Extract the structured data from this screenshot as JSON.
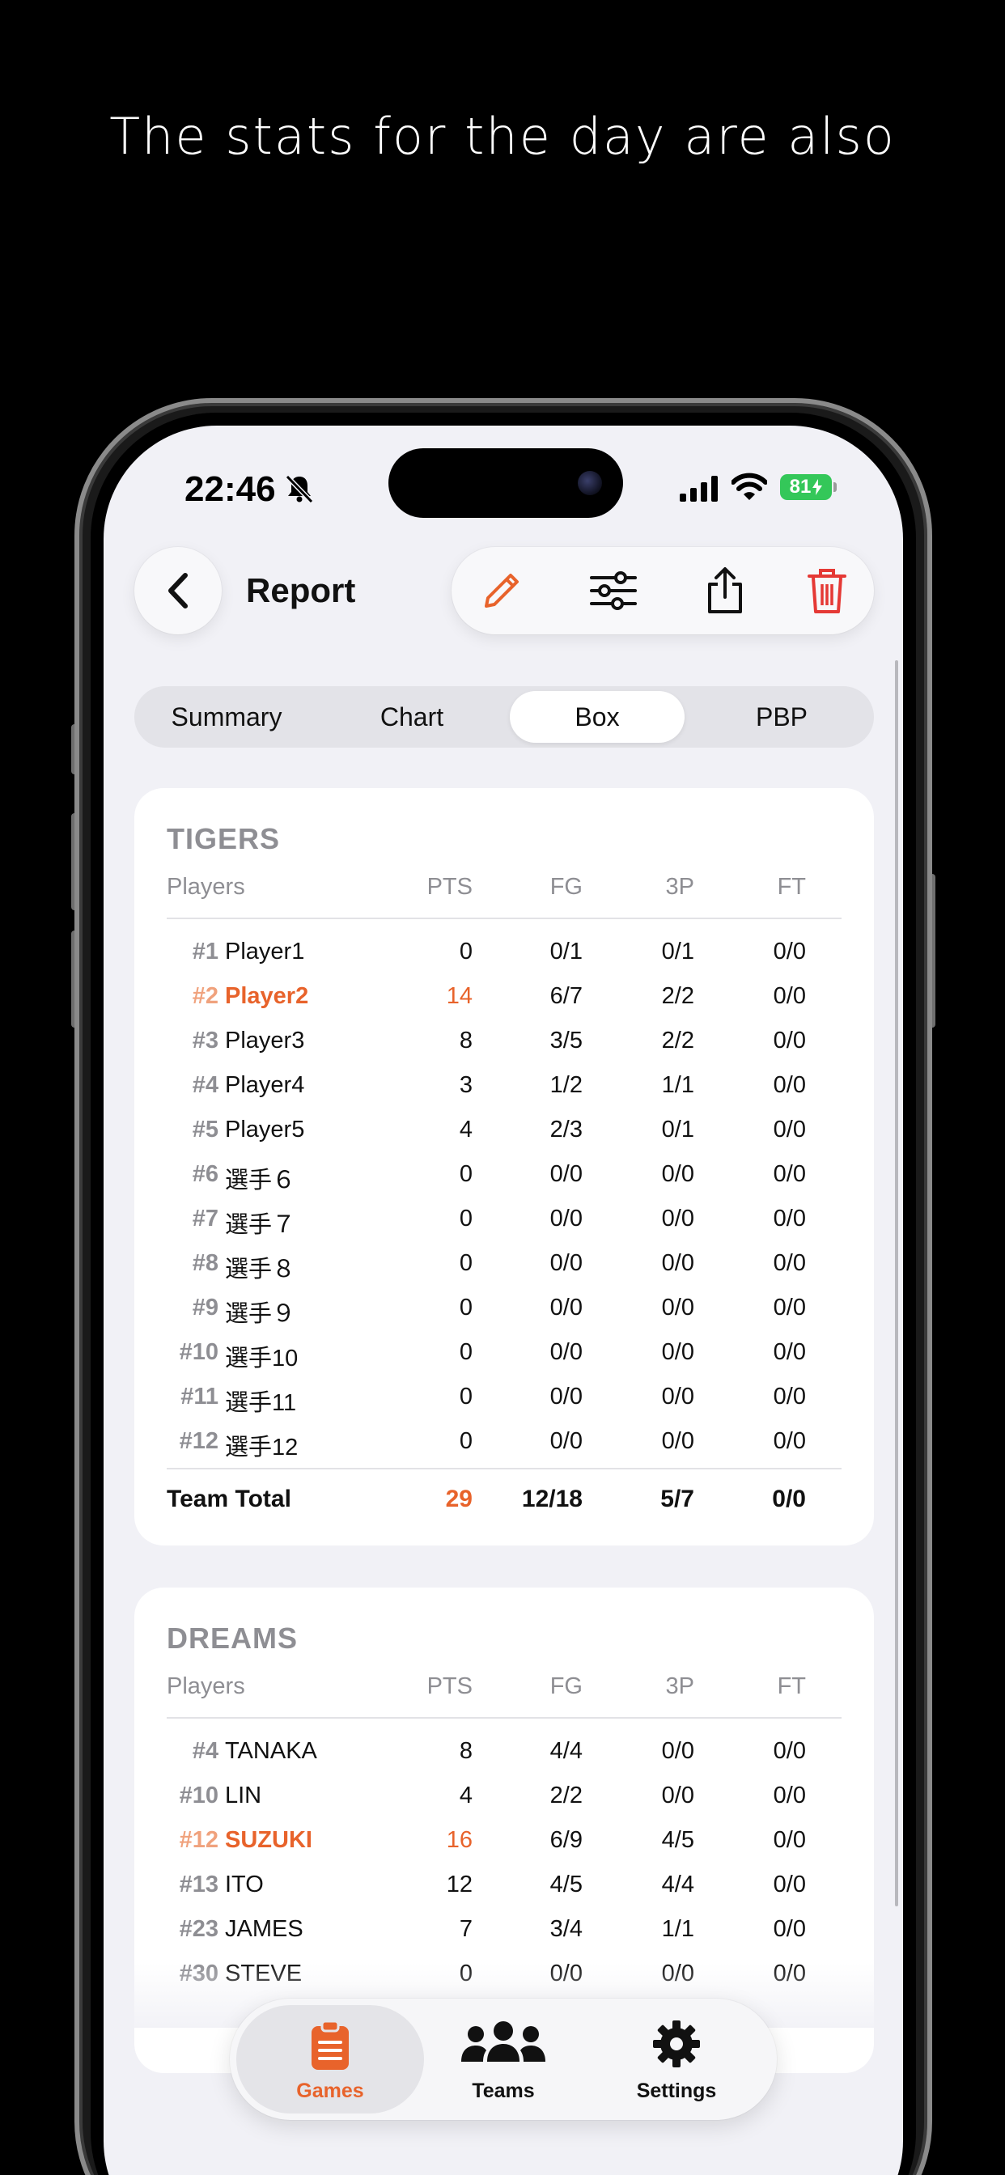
{
  "headline": "The stats for the day are also",
  "status": {
    "time": "22:46",
    "battery": "81"
  },
  "toolbar": {
    "title": "Report"
  },
  "segments": [
    "Summary",
    "Chart",
    "Box",
    "PBP"
  ],
  "active_segment": "Box",
  "columns": {
    "players": "Players",
    "pts": "PTS",
    "fg": "FG",
    "tp": "3P",
    "ft": "FT"
  },
  "teams": [
    {
      "name": "TIGERS",
      "rows": [
        {
          "num": "#1",
          "name": "Player1",
          "pts": "0",
          "fg": "0/1",
          "tp": "0/1",
          "ft": "0/0",
          "highlight": false
        },
        {
          "num": "#2",
          "name": "Player2",
          "pts": "14",
          "fg": "6/7",
          "tp": "2/2",
          "ft": "0/0",
          "highlight": true
        },
        {
          "num": "#3",
          "name": "Player3",
          "pts": "8",
          "fg": "3/5",
          "tp": "2/2",
          "ft": "0/0",
          "highlight": false
        },
        {
          "num": "#4",
          "name": "Player4",
          "pts": "3",
          "fg": "1/2",
          "tp": "1/1",
          "ft": "0/0",
          "highlight": false
        },
        {
          "num": "#5",
          "name": "Player5",
          "pts": "4",
          "fg": "2/3",
          "tp": "0/1",
          "ft": "0/0",
          "highlight": false
        },
        {
          "num": "#6",
          "name": "選手６",
          "pts": "0",
          "fg": "0/0",
          "tp": "0/0",
          "ft": "0/0",
          "highlight": false
        },
        {
          "num": "#7",
          "name": "選手７",
          "pts": "0",
          "fg": "0/0",
          "tp": "0/0",
          "ft": "0/0",
          "highlight": false
        },
        {
          "num": "#8",
          "name": "選手８",
          "pts": "0",
          "fg": "0/0",
          "tp": "0/0",
          "ft": "0/0",
          "highlight": false
        },
        {
          "num": "#9",
          "name": "選手９",
          "pts": "0",
          "fg": "0/0",
          "tp": "0/0",
          "ft": "0/0",
          "highlight": false
        },
        {
          "num": "#10",
          "name": "選手10",
          "pts": "0",
          "fg": "0/0",
          "tp": "0/0",
          "ft": "0/0",
          "highlight": false
        },
        {
          "num": "#11",
          "name": "選手11",
          "pts": "0",
          "fg": "0/0",
          "tp": "0/0",
          "ft": "0/0",
          "highlight": false
        },
        {
          "num": "#12",
          "name": "選手12",
          "pts": "0",
          "fg": "0/0",
          "tp": "0/0",
          "ft": "0/0",
          "highlight": false
        }
      ],
      "total": {
        "label": "Team Total",
        "pts": "29",
        "fg": "12/18",
        "tp": "5/7",
        "ft": "0/0"
      }
    },
    {
      "name": "DREAMS",
      "rows": [
        {
          "num": "#4",
          "name": "TANAKA",
          "pts": "8",
          "fg": "4/4",
          "tp": "0/0",
          "ft": "0/0",
          "highlight": false
        },
        {
          "num": "#10",
          "name": "LIN",
          "pts": "4",
          "fg": "2/2",
          "tp": "0/0",
          "ft": "0/0",
          "highlight": false
        },
        {
          "num": "#12",
          "name": "SUZUKI",
          "pts": "16",
          "fg": "6/9",
          "tp": "4/5",
          "ft": "0/0",
          "highlight": true
        },
        {
          "num": "#13",
          "name": "ITO",
          "pts": "12",
          "fg": "4/5",
          "tp": "4/4",
          "ft": "0/0",
          "highlight": false
        },
        {
          "num": "#23",
          "name": "JAMES",
          "pts": "7",
          "fg": "3/4",
          "tp": "1/1",
          "ft": "0/0",
          "highlight": false
        },
        {
          "num": "#30",
          "name": "STEVE",
          "pts": "0",
          "fg": "0/0",
          "tp": "0/0",
          "ft": "0/0",
          "highlight": false
        }
      ]
    }
  ],
  "tabbar": [
    {
      "label": "Games",
      "icon": "clipboard-icon",
      "active": true
    },
    {
      "label": "Teams",
      "icon": "people-icon",
      "active": false
    },
    {
      "label": "Settings",
      "icon": "gear-icon",
      "active": false
    }
  ],
  "colors": {
    "accent": "#e8632b",
    "delete": "#e53935",
    "battery": "#34c759"
  }
}
